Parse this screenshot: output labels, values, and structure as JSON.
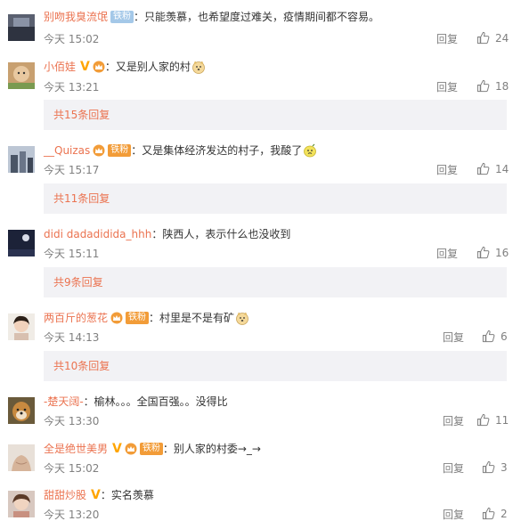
{
  "labels": {
    "reply": "回复",
    "fan_badge": "铁粉"
  },
  "comments": [
    {
      "user": "别吻我臭流氓",
      "text": "：只能羡慕，也希望度过难关，疫情期间都不容易。",
      "time": "今天 15:02",
      "likes": "24",
      "sub_replies": ""
    },
    {
      "user": "小佰娃",
      "text": "：又是别人家的村",
      "time": "今天 13:21",
      "likes": "18",
      "sub_replies": "共15条回复"
    },
    {
      "user": "__Quizas",
      "text": "：又是集体经济发达的村子，我酸了",
      "time": "今天 15:17",
      "likes": "14",
      "sub_replies": "共11条回复"
    },
    {
      "user": "didi dadadidida_hhh",
      "text": "：陕西人，表示什么也没收到",
      "time": "今天 15:11",
      "likes": "16",
      "sub_replies": "共9条回复"
    },
    {
      "user": "两百斤的葱花",
      "text": "：村里是不是有矿",
      "time": "今天 14:13",
      "likes": "6",
      "sub_replies": "共10条回复"
    },
    {
      "user": "-楚天阔-",
      "text": "：榆林。。。全国百强。。没得比",
      "time": "今天 13:30",
      "likes": "11",
      "sub_replies": ""
    },
    {
      "user": "全是绝世美男",
      "text": "：别人家的村委→_→",
      "time": "今天 15:02",
      "likes": "3",
      "sub_replies": ""
    },
    {
      "user": "甜甜炒股",
      "text": "：实名羡慕",
      "time": "今天 13:20",
      "likes": "2",
      "sub_replies": ""
    }
  ],
  "colors": {
    "username": "#eb7350",
    "meta": "#808080",
    "sub_box_bg": "#f2f2f5",
    "badge_orange": "#f29c38",
    "badge_blue": "#a4c8e8",
    "vip_v": "#ffa500"
  },
  "icons": {
    "like": "thumbs-up-icon",
    "vip": "v-badge-icon",
    "crown": "crown-icon",
    "emoji_doge": "doge-emoji-icon",
    "emoji_sour": "lemon-emoji-icon"
  }
}
